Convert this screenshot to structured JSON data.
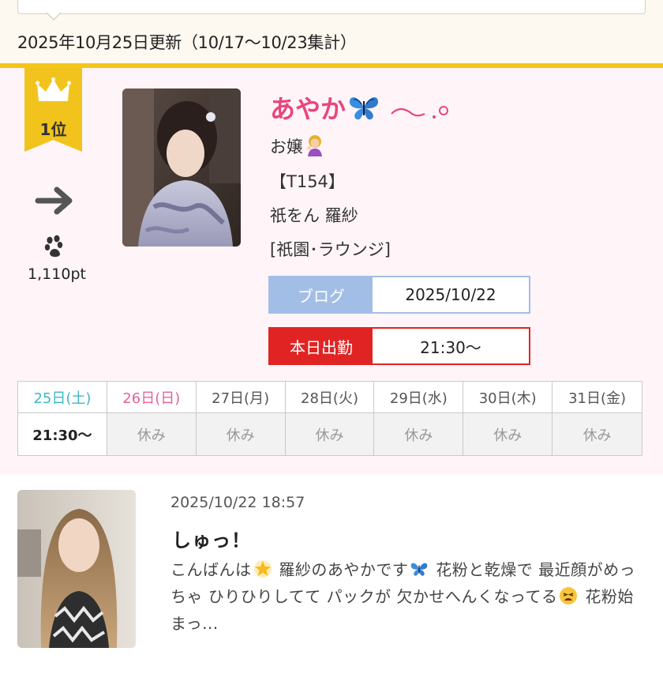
{
  "header": {
    "update_text": "2025年10月25日更新（10/17〜10/23集計）"
  },
  "ranking": {
    "rank_label": "1位",
    "trend_icon": "arrow-right-icon",
    "points": "1,110pt"
  },
  "profile": {
    "name": "あやか",
    "type_line": "お嬢",
    "height_line": "【T154】",
    "shop_name": "祇をん 羅紗",
    "area_line": "[祇園･ラウンジ]",
    "blog_label": "ブログ",
    "blog_date": "2025/10/22",
    "work_label": "本日出勤",
    "work_time": "21:30〜"
  },
  "schedule": {
    "days": [
      {
        "label": "25日(土)",
        "value": "21:30〜",
        "kind": "sat",
        "on": true
      },
      {
        "label": "26日(日)",
        "value": "休み",
        "kind": "sun",
        "on": false
      },
      {
        "label": "27日(月)",
        "value": "休み",
        "kind": "",
        "on": false
      },
      {
        "label": "28日(火)",
        "value": "休み",
        "kind": "",
        "on": false
      },
      {
        "label": "29日(水)",
        "value": "休み",
        "kind": "",
        "on": false
      },
      {
        "label": "30日(木)",
        "value": "休み",
        "kind": "",
        "on": false
      },
      {
        "label": "31日(金)",
        "value": "休み",
        "kind": "",
        "on": false
      }
    ]
  },
  "blog_entry": {
    "datetime": "2025/10/22 18:57",
    "title": "しゅっ！",
    "body_1": "こんばんは",
    "body_2": " 羅紗のあやかです",
    "body_3": " 花粉と乾燥で 最近顔がめっちゃ ひりひりしてて パックが 欠かせへんくなってる",
    "body_4": " 花粉始まっ..."
  },
  "colors": {
    "accent_pink": "#e8457e",
    "gold": "#f2c31c",
    "blog_blue": "#a3bee6",
    "work_red": "#e02424",
    "saturday": "#3db8c5",
    "sunday": "#e8609a"
  }
}
